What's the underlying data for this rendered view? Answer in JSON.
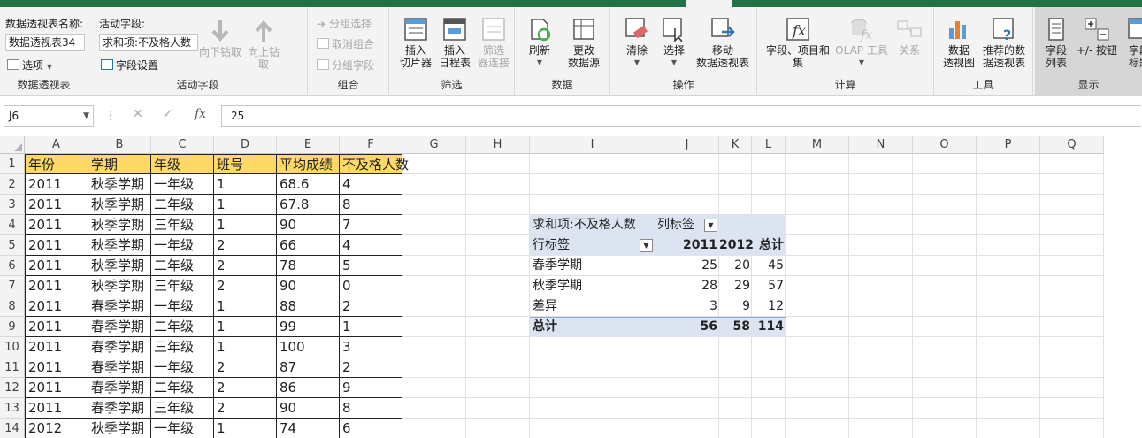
{
  "ribbon": {
    "pivot_group": {
      "name_label": "数据透视表名称:",
      "name_value": "数据透视表34",
      "options_label": "选项",
      "group_label": "数据透视表"
    },
    "active_field_group": {
      "field_label": "活动字段:",
      "field_value": "求和项:不及格人数",
      "field_settings_label": "字段设置",
      "drill_down_label": "向下钻取",
      "drill_up_label_1": "向上钻",
      "drill_up_label_2": "取",
      "group_label": "活动字段"
    },
    "group_group": {
      "group_selection": "分组选择",
      "ungroup": "取消组合",
      "group_field": "分组字段",
      "group_label": "组合"
    },
    "filter_group": {
      "slicer_1": "插入",
      "slicer_2": "切片器",
      "timeline_1": "插入",
      "timeline_2": "日程表",
      "filter_conn_1": "筛选",
      "filter_conn_2": "器连接",
      "group_label": "筛选"
    },
    "data_group": {
      "refresh": "刷新",
      "change_source_1": "更改",
      "change_source_2": "数据源",
      "group_label": "数据"
    },
    "actions_group": {
      "clear": "清除",
      "select": "选择",
      "move_1": "移动",
      "move_2": "数据透视表",
      "group_label": "操作"
    },
    "calc_group": {
      "fields_items_1": "字段、项目和",
      "fields_items_2": "集",
      "olap_tools": "OLAP 工具",
      "relationships": "关系",
      "group_label": "计算"
    },
    "tools_group": {
      "pivot_chart_1": "数据",
      "pivot_chart_2": "透视图",
      "recommended_1": "推荐的数",
      "recommended_2": "据透视表",
      "group_label": "工具"
    },
    "show_group": {
      "field_list_1": "字段",
      "field_list_2": "列表",
      "plus_minus": "+/- 按钮",
      "field_headers_1": "字段",
      "field_headers_2": "标题",
      "group_label": "显示"
    }
  },
  "formula_bar": {
    "name_box": "J6",
    "value": "25"
  },
  "sheet": {
    "columns": [
      "A",
      "B",
      "C",
      "D",
      "E",
      "F",
      "G",
      "H",
      "I",
      "J",
      "K",
      "L",
      "M",
      "N",
      "O",
      "P",
      "Q"
    ],
    "rows": [
      "1",
      "2",
      "3",
      "4",
      "5",
      "6",
      "7",
      "8",
      "9",
      "10",
      "11",
      "12",
      "13",
      "14"
    ],
    "headers": [
      "年份",
      "学期",
      "年级",
      "班号",
      "平均成绩",
      "不及格人数"
    ],
    "data": [
      [
        "2011",
        "秋季学期",
        "一年级",
        "1",
        "68.6",
        "4"
      ],
      [
        "2011",
        "秋季学期",
        "二年级",
        "1",
        "67.8",
        "8"
      ],
      [
        "2011",
        "秋季学期",
        "三年级",
        "1",
        "90",
        "7"
      ],
      [
        "2011",
        "秋季学期",
        "一年级",
        "2",
        "66",
        "4"
      ],
      [
        "2011",
        "秋季学期",
        "二年级",
        "2",
        "78",
        "5"
      ],
      [
        "2011",
        "秋季学期",
        "三年级",
        "2",
        "90",
        "0"
      ],
      [
        "2011",
        "春季学期",
        "一年级",
        "1",
        "88",
        "2"
      ],
      [
        "2011",
        "春季学期",
        "二年级",
        "1",
        "99",
        "1"
      ],
      [
        "2011",
        "春季学期",
        "三年级",
        "1",
        "100",
        "3"
      ],
      [
        "2011",
        "春季学期",
        "一年级",
        "2",
        "87",
        "2"
      ],
      [
        "2011",
        "春季学期",
        "二年级",
        "2",
        "86",
        "9"
      ],
      [
        "2011",
        "春季学期",
        "三年级",
        "2",
        "90",
        "8"
      ],
      [
        "2012",
        "秋季学期",
        "一年级",
        "1",
        "74",
        "6"
      ]
    ]
  },
  "pivot": {
    "value_field": "求和项:不及格人数",
    "column_labels": "列标签",
    "row_labels": "行标签",
    "col_headers": [
      "2011",
      "2012",
      "总计"
    ],
    "rows": [
      {
        "label": "春季学期",
        "values": [
          "25",
          "20",
          "45"
        ]
      },
      {
        "label": "秋季学期",
        "values": [
          "28",
          "29",
          "57"
        ]
      },
      {
        "label": "差异",
        "values": [
          "3",
          "9",
          "12"
        ]
      }
    ],
    "total": {
      "label": "总计",
      "values": [
        "56",
        "58",
        "114"
      ]
    }
  },
  "colors": {
    "header_fill": "#ffd966",
    "pivot_header_fill": "#dce3f1",
    "excel_green": "#217346"
  }
}
